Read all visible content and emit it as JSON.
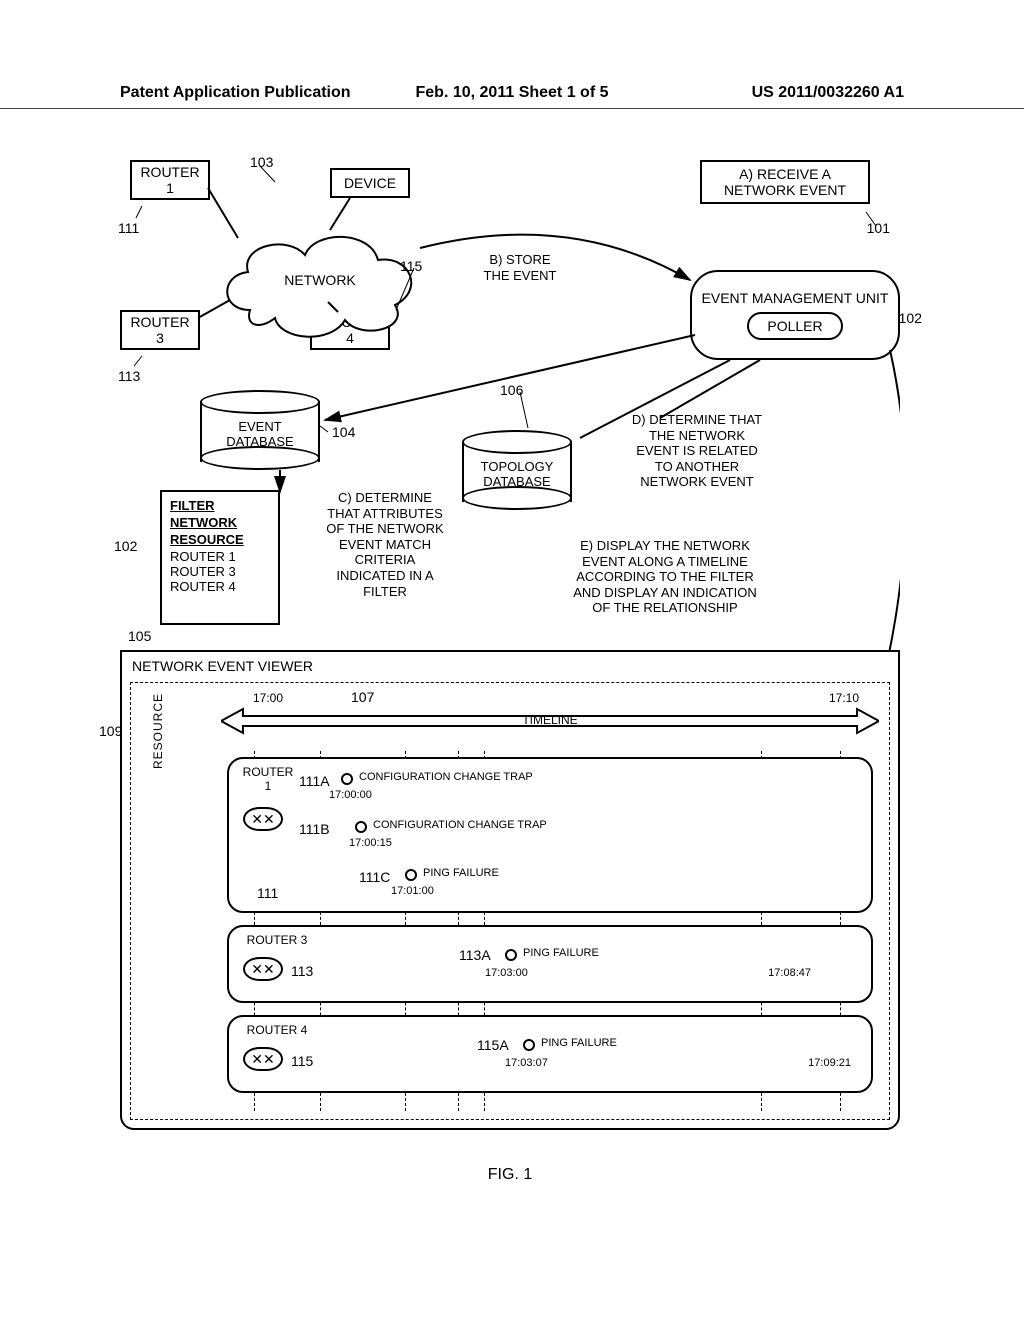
{
  "page_meta": {
    "pub_left": "Patent Application Publication",
    "pub_center": "Feb. 10, 2011  Sheet 1 of 5",
    "pub_right": "US 2011/0032260 A1"
  },
  "figure_label": "FIG. 1",
  "nodes": {
    "router1": "ROUTER\n1",
    "router3": "ROUTER\n3",
    "router4": "ROUTER\n4",
    "device": "DEVICE",
    "network": "NETWORK",
    "event_db": "EVENT\nDATABASE",
    "topology_db": "TOPOLOGY\nDATABASE",
    "emu_title": "EVENT MANAGEMENT UNIT",
    "poller": "POLLER"
  },
  "filter_panel": {
    "heading": "FILTER",
    "col1": "NETWORK",
    "col2": "RESOURCE",
    "rows": [
      "ROUTER 1",
      "ROUTER 3",
      "ROUTER 4"
    ]
  },
  "steps": {
    "A": "A) RECEIVE A\nNETWORK EVENT",
    "B": "B) STORE\nTHE EVENT",
    "C": "C) DETERMINE\nTHAT ATTRIBUTES\nOF THE NETWORK\nEVENT MATCH\nCRITERIA\nINDICATED IN A\nFILTER",
    "D": "D) DETERMINE THAT\nTHE NETWORK\nEVENT IS RELATED\nTO ANOTHER\nNETWORK EVENT",
    "E": "E) DISPLAY THE NETWORK\nEVENT ALONG A TIMELINE\nACCORDING TO THE FILTER\nAND DISPLAY AN INDICATION\nOF THE RELATIONSHIP"
  },
  "ref_numerals": {
    "n101": "101",
    "n102a": "102",
    "n102b": "102",
    "n103": "103",
    "n104": "104",
    "n105": "105",
    "n106": "106",
    "n107": "107",
    "n109": "109",
    "n111": "111",
    "n111A": "111A",
    "n111B": "111B",
    "n111C": "111C",
    "n111_icon": "111",
    "n113": "113",
    "n113A": "113A",
    "n113_icon": "113",
    "n115": "115",
    "n115A": "115A",
    "n115_icon": "115"
  },
  "viewer": {
    "title": "NETWORK EVENT VIEWER",
    "resource_axis": "RESOURCE",
    "timeline_label": "TIMELINE",
    "t_start": "17:00",
    "t_end": "17:10",
    "lanes": [
      {
        "name": "ROUTER\n1",
        "icon_ref": "111",
        "events": [
          {
            "ref": "111A",
            "label": "CONFIGURATION CHANGE TRAP",
            "time": "17:00:00",
            "x_pct": 7
          },
          {
            "ref": "111B",
            "label": "CONFIGURATION CHANGE TRAP",
            "time": "17:00:15",
            "x_pct": 10
          },
          {
            "ref": "111C",
            "label": "PING FAILURE",
            "time": "17:01:00",
            "x_pct": 18
          }
        ]
      },
      {
        "name": "ROUTER 3",
        "icon_ref": "113",
        "events": [
          {
            "ref": "113A",
            "label": "PING FAILURE",
            "time": "17:03:00",
            "x_pct": 37,
            "end_time": "17:08:47",
            "end_x_pct": 85
          }
        ]
      },
      {
        "name": "ROUTER 4",
        "icon_ref": "115",
        "events": [
          {
            "ref": "115A",
            "label": "PING FAILURE",
            "time": "17:03:07",
            "x_pct": 39,
            "end_time": "17:09:21",
            "end_x_pct": 92
          }
        ]
      }
    ]
  }
}
